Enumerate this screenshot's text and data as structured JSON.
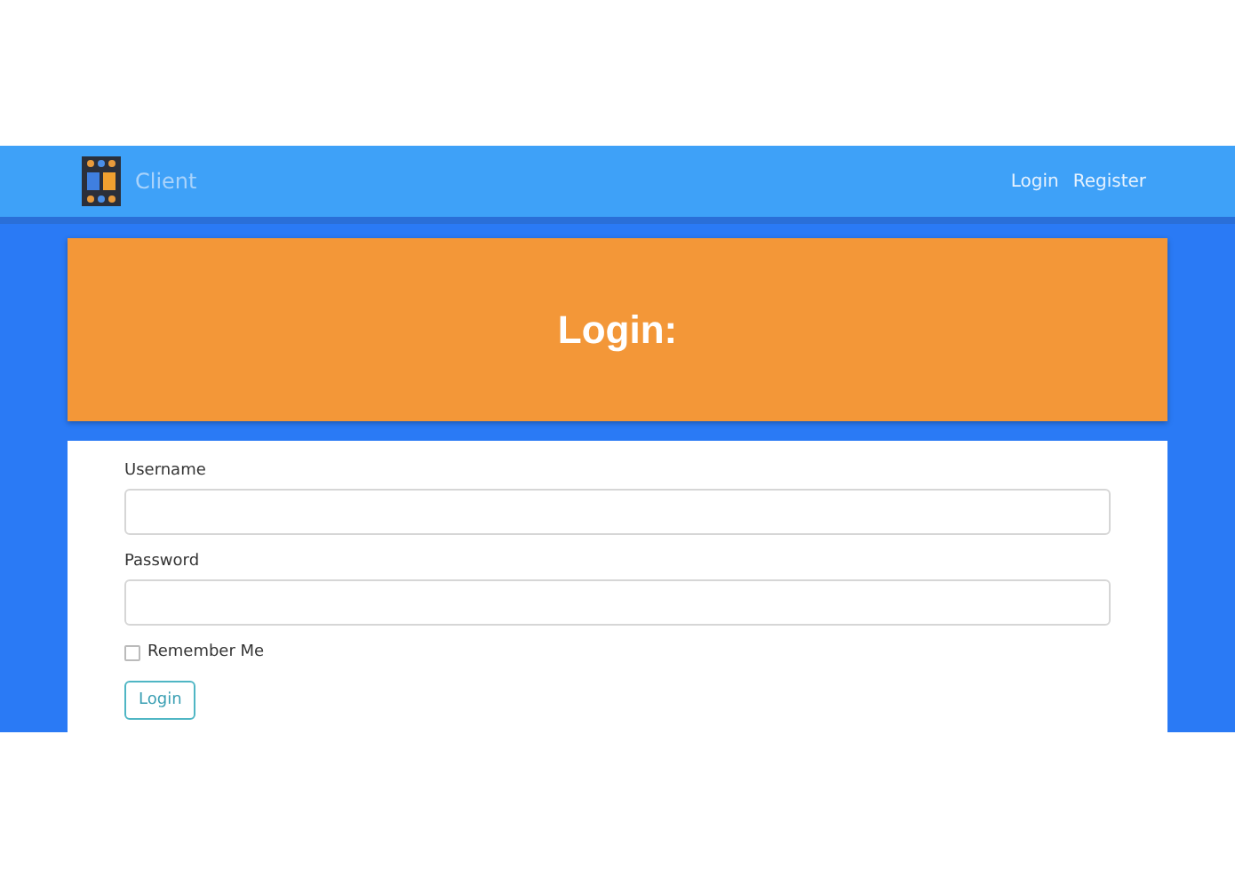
{
  "navbar": {
    "brand": "Client",
    "links": [
      {
        "label": "Login"
      },
      {
        "label": "Register"
      }
    ]
  },
  "header": {
    "title": "Login:"
  },
  "form": {
    "fields": [
      {
        "label": "Username"
      },
      {
        "label": "Password"
      }
    ],
    "remember": {
      "label": "Remember Me",
      "checked": false
    },
    "submit": "Login"
  }
}
